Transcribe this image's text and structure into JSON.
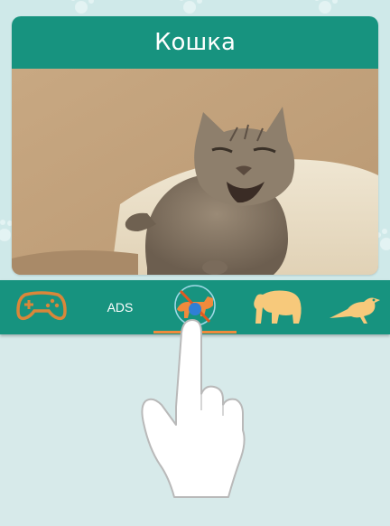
{
  "card": {
    "title": "Кошка",
    "image_icon": "cat-photo"
  },
  "bottom_nav": {
    "items": [
      {
        "id": "games",
        "icon": "gamepad-icon"
      },
      {
        "id": "ads",
        "label": "ADS"
      },
      {
        "id": "no-dogs",
        "icon": "no-dog-icon",
        "selected": true
      },
      {
        "id": "bear",
        "icon": "bear-icon"
      },
      {
        "id": "bird",
        "icon": "bird-icon"
      }
    ]
  },
  "overlay": {
    "icon": "pointing-hand-icon"
  },
  "colors": {
    "header": "#17937f",
    "nav_bar": "#17937f",
    "accent_orange": "#f08a3c",
    "animal_icon": "#f7c97b",
    "background": "#d7eaea"
  }
}
